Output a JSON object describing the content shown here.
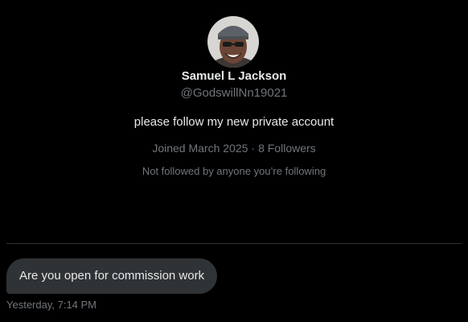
{
  "profile": {
    "display_name": "Samuel L Jackson",
    "handle": "@GodswillNn19021",
    "bio": "please follow my new private account",
    "joined": "Joined March 2025",
    "separator": "·",
    "followers": "8 Followers",
    "followed_by_note": "Not followed by anyone you’re following",
    "avatar": "profile-photo"
  },
  "conversation": {
    "messages": [
      {
        "text": "Are you open for commission work",
        "timestamp": "Yesterday, 7:14 PM"
      }
    ]
  },
  "colors": {
    "background": "#000000",
    "primary_text": "#e7e9ea",
    "secondary_text": "#71767b",
    "bubble": "#2f3336",
    "divider": "#2f3336"
  }
}
